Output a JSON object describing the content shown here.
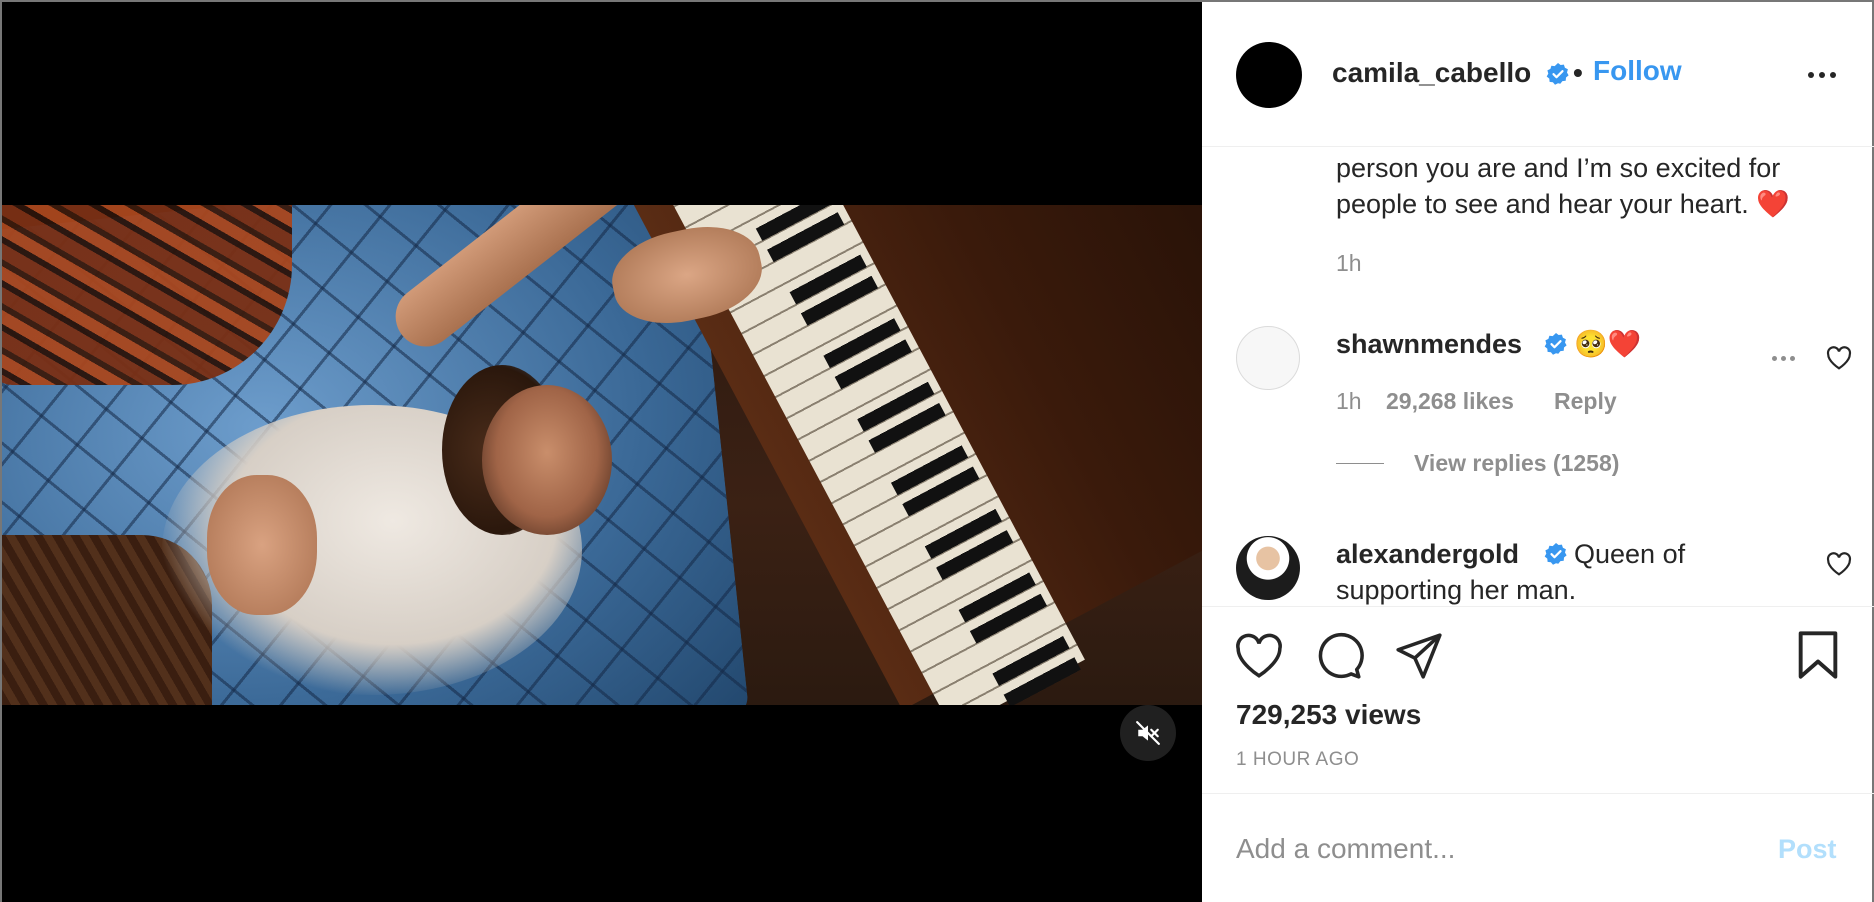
{
  "post": {
    "username": "camila_cabello",
    "separator": "•",
    "follow_label": "Follow",
    "views_label": "729,253 views",
    "time_label": "1 HOUR AGO"
  },
  "comments": {
    "caption_line1": "person you are and I’m so excited for",
    "caption_line2": "people to see and hear your heart. ❤️",
    "caption_time": "1h",
    "c1": {
      "user": "shawnmendes",
      "text": "🥺❤️",
      "time": "1h",
      "likes": "29,268 likes",
      "reply": "Reply",
      "view_replies": "View replies (1258)"
    },
    "c2": {
      "user": "alexandergold",
      "text": "Queen of",
      "text2": "supporting her man."
    }
  },
  "comment_box": {
    "placeholder": "Add a comment...",
    "post_label": "Post"
  },
  "colors": {
    "accent": "#3897f0",
    "verified": "#3897f0",
    "muted": "#8e8e8e",
    "post_disabled": "#b2dffc"
  },
  "icons": {
    "mute": "speaker-muted-icon",
    "like": "heart-icon",
    "comment": "speech-bubble-icon",
    "share": "paper-plane-icon",
    "save": "bookmark-icon",
    "more": "ellipsis-icon",
    "verified": "verified-badge-icon"
  }
}
